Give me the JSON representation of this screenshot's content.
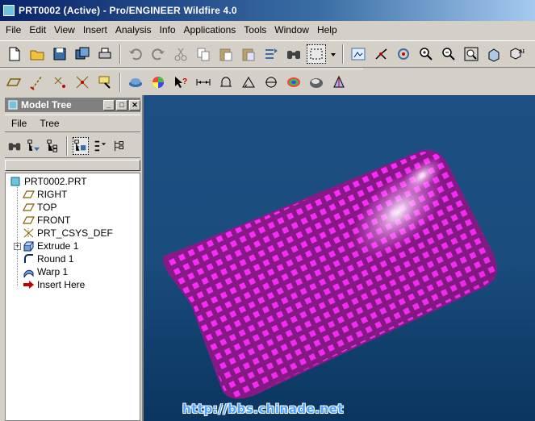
{
  "window": {
    "title": "PRT0002 (Active) - Pro/ENGINEER Wildfire 4.0"
  },
  "menubar": {
    "items": [
      "File",
      "Edit",
      "View",
      "Insert",
      "Analysis",
      "Info",
      "Applications",
      "Tools",
      "Window",
      "Help"
    ]
  },
  "toolbar1": {
    "icons": [
      "new-file-icon",
      "open-folder-icon",
      "save-icon",
      "save-copy-icon",
      "print-icon",
      "undo-icon",
      "redo-icon",
      "cut-icon",
      "copy-icon",
      "paste-icon",
      "paste-special-icon",
      "regenerate-icon",
      "find-binoculars-icon",
      "select-box-icon",
      "dropdown-arrow-icon",
      "repaint-icon",
      "spin-center-icon",
      "orient-mode-icon",
      "zoom-in-icon",
      "zoom-out-icon",
      "refit-icon",
      "named-view-icon",
      "saved-views-icon"
    ]
  },
  "toolbar2": {
    "icons": [
      "datum-plane-icon",
      "datum-axis-icon",
      "datum-point-icon",
      "datum-csys-icon",
      "sketch-icon",
      "appearance-icon",
      "color-wheel-icon",
      "help-pointer-icon",
      "measure-distance-icon",
      "measure-area-icon",
      "measure-angle-icon",
      "section-icon",
      "curvature-analysis-icon",
      "shading-analysis-icon",
      "draft-analysis-icon"
    ]
  },
  "model_tree": {
    "title": "Model Tree",
    "menu": [
      "File",
      "Tree"
    ],
    "items": [
      {
        "label": "PRT0002.PRT",
        "icon": "part-icon",
        "level": 0
      },
      {
        "label": "RIGHT",
        "icon": "datum-plane-icon",
        "level": 1
      },
      {
        "label": "TOP",
        "icon": "datum-plane-icon",
        "level": 1
      },
      {
        "label": "FRONT",
        "icon": "datum-plane-icon",
        "level": 1
      },
      {
        "label": "PRT_CSYS_DEF",
        "icon": "csys-icon",
        "level": 1
      },
      {
        "label": "Extrude 1",
        "icon": "extrude-icon",
        "level": 1,
        "expandable": true
      },
      {
        "label": "Round 1",
        "icon": "round-icon",
        "level": 1
      },
      {
        "label": "Warp 1",
        "icon": "warp-icon",
        "level": 1
      },
      {
        "label": "Insert Here",
        "icon": "insert-arrow-icon",
        "level": 1
      }
    ]
  },
  "viewport": {
    "watermark": "http://bbs.chinade.net",
    "colors": {
      "background_top": "#1e4f84",
      "background_bottom": "#0a3560",
      "model_base": "#8a1a8a",
      "model_pattern": "#ff2cff"
    }
  }
}
